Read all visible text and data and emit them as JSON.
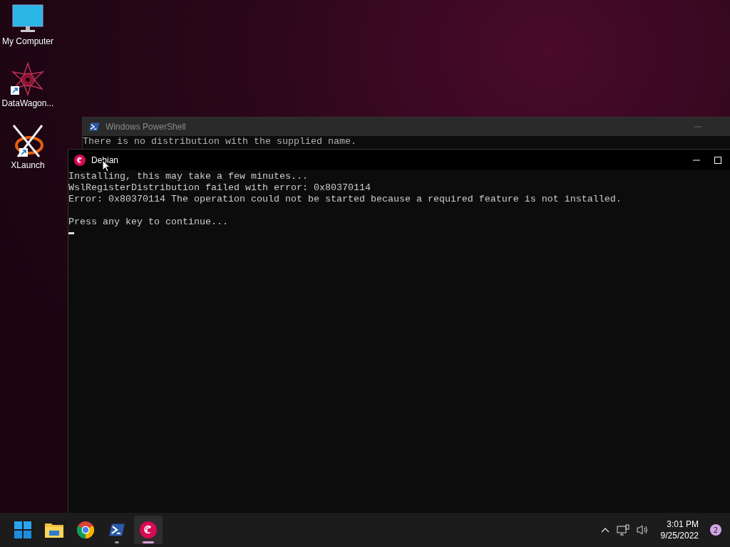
{
  "desktop_icons": [
    {
      "label": "My Computer",
      "kind": "computer",
      "shortcut": false
    },
    {
      "label": "DataWagon...",
      "kind": "star",
      "shortcut": true
    },
    {
      "label": "XLaunch",
      "kind": "x",
      "shortcut": true
    }
  ],
  "background_window": {
    "title": "Windows PowerShell",
    "lines": [
      "There is no distribution with the supplied name."
    ]
  },
  "console_window": {
    "title": "Debian",
    "blocks": [
      [
        "Installing, this may take a few minutes...",
        "WslRegisterDistribution failed with error: 0x80370114",
        "Error: 0x80370114 The operation could not be started because a required feature is not installed."
      ],
      [
        "Press any key to continue..."
      ]
    ]
  },
  "taskbar": {
    "apps": [
      {
        "kind": "start",
        "running": false,
        "selected": false
      },
      {
        "kind": "folder",
        "running": false,
        "selected": false
      },
      {
        "kind": "chrome",
        "running": false,
        "selected": false
      },
      {
        "kind": "powershell",
        "running": true,
        "selected": false
      },
      {
        "kind": "debian",
        "running": true,
        "selected": true
      }
    ],
    "time": "3:01 PM",
    "date": "9/25/2022",
    "notifications": "2"
  }
}
